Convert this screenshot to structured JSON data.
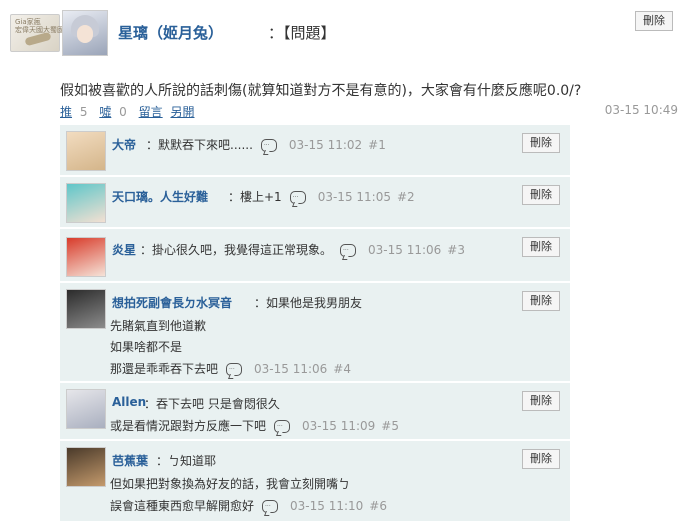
{
  "post": {
    "badge_text": "Gia家瘋\n宏偉天國大蜀國",
    "author": "星璃（姬月兔）",
    "tag": "：【問題】",
    "delete_label": "刪除",
    "text": "假如被喜歡的人所說的話刺傷(就算知道對方不是有意的)，大家會有什麼反應呢0.0/?",
    "actions": {
      "push": "推",
      "push_count": "5",
      "boo": "噓",
      "boo_count": "0",
      "reply": "留言",
      "share": "另開"
    },
    "time": "03-15 10:49"
  },
  "comments": [
    {
      "name": "大帝",
      "lines": [
        "：默默吞下來吧......"
      ],
      "time": "03-15 11:02",
      "floor": "#1",
      "delete_label": "刪除",
      "avatar_colors": [
        "#f2dcc0",
        "#d4b58a"
      ]
    },
    {
      "name": "天口璃。人生好難",
      "lines": [
        "：樓上+1"
      ],
      "time": "03-15 11:05",
      "floor": "#2",
      "delete_label": "刪除",
      "avatar_colors": [
        "#5fc6c9",
        "#f3e0d2"
      ]
    },
    {
      "name": "炎星",
      "lines": [
        "：掛心很久吧，我覺得這正常現象。"
      ],
      "time": "03-15 11:06",
      "floor": "#3",
      "delete_label": "刪除",
      "avatar_colors": [
        "#d83b2a",
        "#f5e3d8"
      ]
    },
    {
      "name": "想拍死副會長ㄉ水冥音",
      "lines": [
        "：如果他是我男朋友",
        "先賭氣直到他道歉",
        "如果啥都不是",
        "那還是乖乖吞下去吧"
      ],
      "time": "03-15 11:06",
      "floor": "#4",
      "delete_label": "刪除",
      "avatar_colors": [
        "#2b2b2b",
        "#8c8c8c"
      ]
    },
    {
      "name": "Allen",
      "lines": [
        "：吞下去吧 只是會悶很久",
        "或是看情況跟對方反應一下吧"
      ],
      "time": "03-15 11:09",
      "floor": "#5",
      "delete_label": "刪除",
      "avatar_colors": [
        "#e6e6ea",
        "#a9afbf"
      ]
    },
    {
      "name": "芭蕉葉",
      "lines": [
        "：ㄅ知道耶",
        "但如果把對象換為好友的話，我會立刻開嘴ㄅ",
        "誤會這種東西愈早解開愈好"
      ],
      "time": "03-15 11:10",
      "floor": "#6",
      "delete_label": "刪除",
      "avatar_colors": [
        "#4a3a2a",
        "#c49a6c"
      ]
    }
  ]
}
